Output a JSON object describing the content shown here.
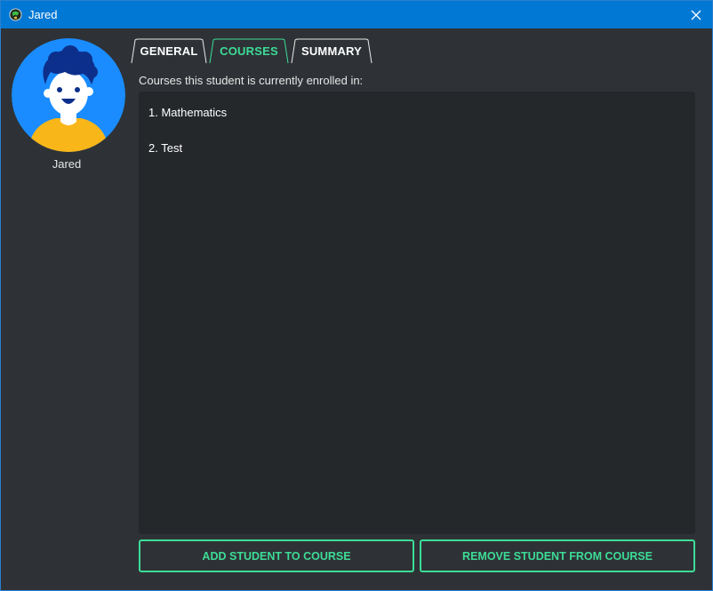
{
  "window": {
    "title": "Jared"
  },
  "student": {
    "name": "Jared"
  },
  "tabs": [
    {
      "label": "GENERAL",
      "active": false
    },
    {
      "label": "COURSES",
      "active": true
    },
    {
      "label": "SUMMARY",
      "active": false
    }
  ],
  "courses_panel": {
    "label": "Courses this student is currently enrolled in:",
    "items": [
      "1. Mathematics",
      "2. Test"
    ]
  },
  "actions": {
    "add_label": "ADD STUDENT TO COURSE",
    "remove_label": "REMOVE STUDENT FROM COURSE"
  },
  "colors": {
    "titlebar": "#0078d4",
    "background": "#2e3236",
    "panel": "#25282b",
    "accent": "#3ddc97",
    "avatar_bg": "#1a8cff",
    "avatar_shirt": "#f8b619",
    "avatar_hair": "#0d2f8c"
  },
  "icons": {
    "app": "globe-icon",
    "close": "close-icon",
    "avatar": "student-avatar"
  }
}
